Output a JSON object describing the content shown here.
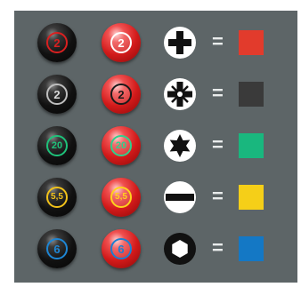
{
  "equals": "=",
  "rows": [
    {
      "label": "2",
      "ring_color_black": "#d92020",
      "ring_color_red": "#ffffff",
      "drive": "phillips-cross-icon",
      "color": "#e23b2c"
    },
    {
      "label": "2",
      "ring_color_black": "#bfbfbf",
      "ring_color_red": "#1a1a1a",
      "drive": "pozidriv-star-icon",
      "color": "#3a3a3a"
    },
    {
      "label": "20",
      "ring_color_black": "#1ec27a",
      "ring_color_red": "#2fd08c",
      "drive": "torx-star-icon",
      "color": "#19b77e"
    },
    {
      "label": "5,5",
      "ring_color_black": "#f2c21a",
      "ring_color_red": "#ffd21c",
      "drive": "slotted-line-icon",
      "color": "#f5cf18"
    },
    {
      "label": "6",
      "ring_color_black": "#1e86d4",
      "ring_color_red": "#1e7fd0",
      "drive": "hex-socket-icon",
      "color": "#1478c5"
    }
  ]
}
